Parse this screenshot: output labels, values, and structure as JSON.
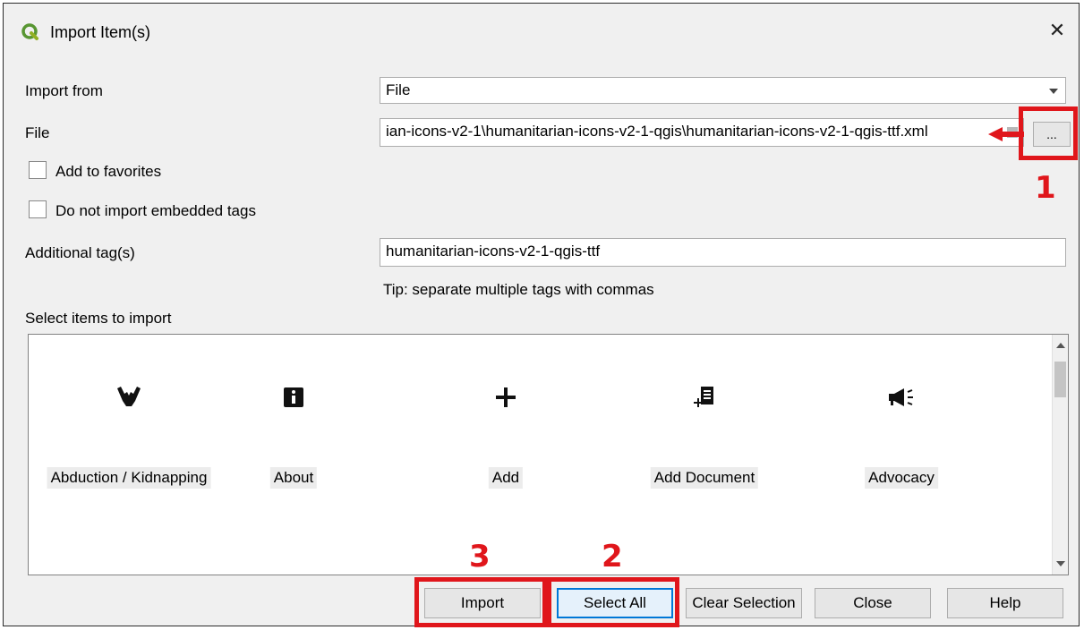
{
  "window": {
    "title": "Import Item(s)",
    "close_symbol": "✕"
  },
  "form": {
    "import_from_label": "Import from",
    "import_from_value": "File",
    "file_label": "File",
    "file_path": "ian-icons-v2-1\\humanitarian-icons-v2-1-qgis\\humanitarian-icons-v2-1-qgis-ttf.xml",
    "browse_label": "...",
    "add_favorites_label": "Add to favorites",
    "add_favorites_checked": false,
    "no_embedded_tags_label": "Do not import embedded tags",
    "no_embedded_tags_checked": false,
    "additional_tags_label": "Additional tag(s)",
    "additional_tags_value": "humanitarian-icons-v2-1-qgis-ttf",
    "tip": "Tip: separate multiple tags with commas",
    "select_items_label": "Select items to import"
  },
  "items": [
    {
      "name": "Abduction / Kidnapping",
      "icon": "abduction-icon"
    },
    {
      "name": "About",
      "icon": "info-icon"
    },
    {
      "name": "Add",
      "icon": "plus-icon"
    },
    {
      "name": "Add Document",
      "icon": "add-document-icon"
    },
    {
      "name": "Advocacy",
      "icon": "megaphone-icon"
    }
  ],
  "buttons": {
    "import": "Import",
    "select_all": "Select All",
    "clear_selection": "Clear Selection",
    "close": "Close",
    "help": "Help"
  },
  "annotations": {
    "step1": "1",
    "step2": "2",
    "step3": "3"
  },
  "colors": {
    "annotation_red": "#e0161b",
    "focus_blue": "#0078d7"
  }
}
